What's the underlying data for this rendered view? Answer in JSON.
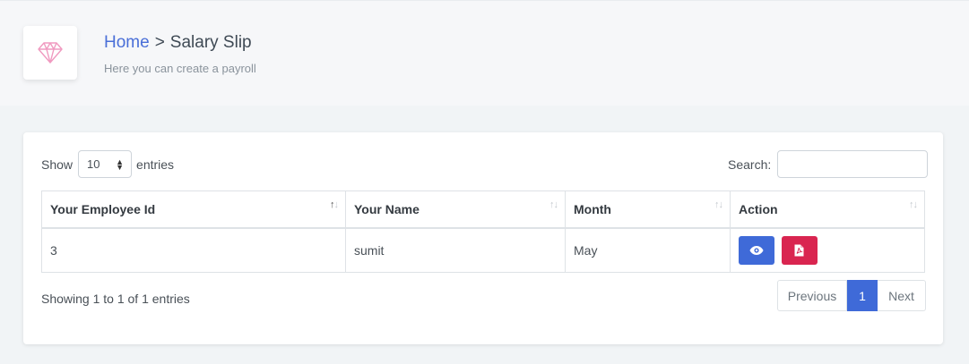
{
  "header": {
    "breadcrumb_home": "Home",
    "breadcrumb_sep": ">",
    "breadcrumb_current": "Salary Slip",
    "subtitle": "Here you can create a payroll",
    "icon": "diamond-icon"
  },
  "length_menu": {
    "show_label": "Show",
    "selected": "10",
    "entries_label": "entries"
  },
  "search": {
    "label": "Search:",
    "value": ""
  },
  "table": {
    "columns": [
      "Your Employee Id",
      "Your Name",
      "Month",
      "Action"
    ],
    "rows": [
      {
        "employee_id": "3",
        "name": "sumit",
        "month": "May"
      }
    ]
  },
  "actions": {
    "view_icon": "eye-icon",
    "pdf_icon": "file-pdf-icon"
  },
  "footer": {
    "info": "Showing 1 to 1 of 1 entries",
    "previous": "Previous",
    "current_page": "1",
    "next": "Next"
  },
  "colors": {
    "primary": "#3f6ad8",
    "danger": "#d92550",
    "link": "#4a6fd8",
    "diamond": "#f09ac0"
  }
}
